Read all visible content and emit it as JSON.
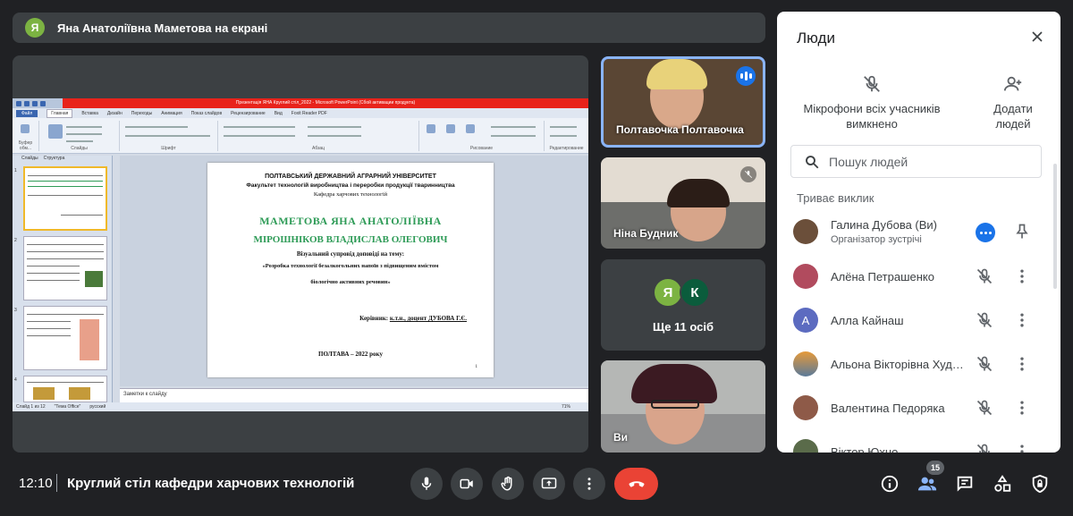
{
  "banner": {
    "avatar_letter": "Я",
    "text": "Яна Анатоліївна Маметова на екрані"
  },
  "presentation": {
    "window_title": "Презентація ЯНА Круглий стіл_2022 - Microsoft PowerPoint (Сбой активации продукта)",
    "tabs": [
      "Файл",
      "Главная",
      "Вставка",
      "Дизайн",
      "Переходы",
      "Анимация",
      "Показ слайдов",
      "Рецензирование",
      "Вид",
      "Foxit Reader PDF"
    ],
    "ribbon_groups": [
      "Буфер обм...",
      "Слайды",
      "Шрифт",
      "Абзац",
      "Рисование",
      "Редактирование"
    ],
    "pane_tabs": [
      "Слайды",
      "Структура"
    ],
    "slide": {
      "line1": "ПОЛТАВСЬКИЙ ДЕРЖАВНИЙ АГРАРНИЙ УНІВЕРСИТЕТ",
      "line2": "Факультет технологій виробництва і переробки продукції тваринництва",
      "line3": "Кафедра харчових технологій",
      "author1": "МАМЕТОВА ЯНА   АНАТОЛІЇВНА",
      "author2": "МІРОШНІКОВ ВЛАДИСЛАВ ОЛЕГОВИЧ",
      "subtitle": "Візуальний супровід доповіді на тему:",
      "topic1": "«Розробка технології безалкогольних напоїв  з підвищеним вмістом",
      "topic2": "біологічно активних речовин»",
      "supervisor_label": "Керівник:",
      "supervisor": "к.т.н., доцент ДУБОВА Г.Є.",
      "footer": "ПОЛТАВА   – 2022 року",
      "page": "1"
    },
    "notes_placeholder": "Заметки к слайду",
    "status_bar": [
      "Слайд 1 из 12",
      "\"Тема Office\"",
      "русский",
      "71%"
    ]
  },
  "tiles": [
    {
      "name": "Полтавочка Полтавочка"
    },
    {
      "name": "Ніна Будник"
    },
    {
      "avatars": [
        "Я",
        "К"
      ],
      "more": "Ще 11 осіб"
    },
    {
      "name": "Ви"
    }
  ],
  "colors": {
    "speaking": "#1a73e8",
    "end_call": "#ea4335",
    "avatar_ya": "#7cb342",
    "avatar_k": "#0b5c3c",
    "avatar_alla": "#5c6bc0"
  },
  "people_panel": {
    "title": "Люди",
    "mute_all": "Мікрофони всіх учасників вимкнено",
    "add_people": "Додати людей",
    "search_placeholder": "Пошук людей",
    "section": "Триває виклик",
    "participants": [
      {
        "name": "Галина Дубова (Ви)",
        "role": "Організатор зустрічі"
      },
      {
        "name": "Алёна Петрашенко"
      },
      {
        "name": "Алла Кайнаш",
        "letter": "А"
      },
      {
        "name": "Альона Вікторівна Худо..."
      },
      {
        "name": "Валентина Педоряка"
      },
      {
        "name": "Віктор Юхно"
      }
    ]
  },
  "bottom_bar": {
    "time": "12:10",
    "meeting_title": "Круглий стіл кафедри харчових технологій",
    "people_count": "15"
  }
}
